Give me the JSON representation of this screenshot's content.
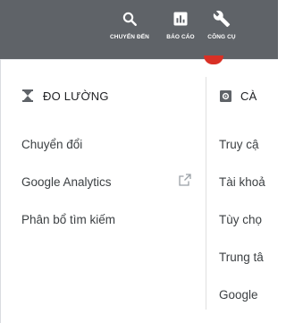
{
  "toolbar": {
    "goto_label": "CHUYỂN ĐẾN",
    "reports_label": "BÁO CÁO",
    "tools_label": "CÔNG CỤ",
    "bg_color": "#5f6368"
  },
  "left_section": {
    "icon": "hourglass-icon",
    "title": "ĐO LƯỜNG",
    "items": [
      {
        "label": "Chuyển đổi"
      },
      {
        "label": "Google Analytics",
        "trailing_icon": "open-in-new-icon"
      },
      {
        "label": "Phân bổ tìm kiếm"
      }
    ]
  },
  "right_section": {
    "icon": "settings-gear-icon",
    "title": "CÀ",
    "items": [
      {
        "label": "Truy cậ"
      },
      {
        "label": "Tài khoả"
      },
      {
        "label": "Tùy chọ"
      },
      {
        "label": "Trung tâ"
      },
      {
        "label": "Google"
      }
    ]
  }
}
